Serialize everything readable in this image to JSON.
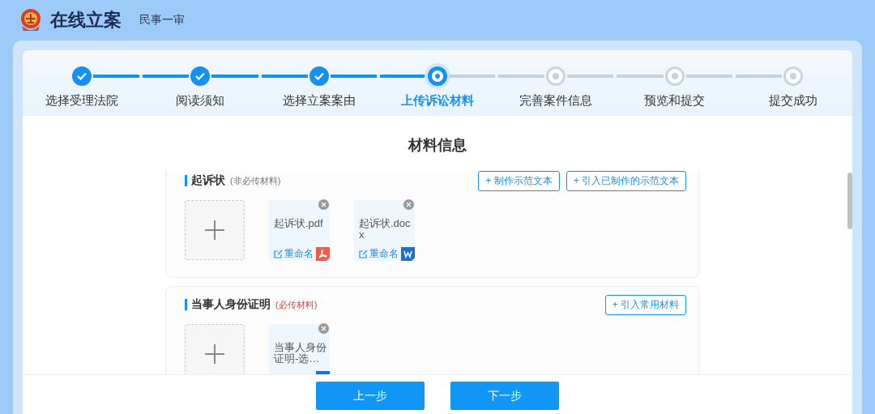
{
  "header": {
    "title": "在线立案",
    "subtitle": "民事一审"
  },
  "steps": [
    {
      "label": "选择受理法院",
      "done": true,
      "current": false
    },
    {
      "label": "阅读须知",
      "done": true,
      "current": false
    },
    {
      "label": "选择立案案由",
      "done": true,
      "current": false
    },
    {
      "label": "上传诉讼材料",
      "done": false,
      "current": true
    },
    {
      "label": "完善案件信息",
      "done": false,
      "current": false
    },
    {
      "label": "预览和提交",
      "done": false,
      "current": false
    },
    {
      "label": "提交成功",
      "done": false,
      "current": false
    }
  ],
  "page_title": "材料信息",
  "sections": [
    {
      "title": "起诉状",
      "note": "(非必传材料)",
      "required": false,
      "buttons": [
        "+ 制作示范文本",
        "+ 引入已制作的示范文本"
      ],
      "files": [
        {
          "name": "起诉状.pdf",
          "rename": "重命名",
          "kind": "pdf"
        },
        {
          "name": "起诉状.docx",
          "rename": "重命名",
          "kind": "word"
        }
      ]
    },
    {
      "title": "当事人身份证明",
      "note": "(必传材料)",
      "required": true,
      "buttons": [
        "+ 引入常用材料"
      ],
      "files": [
        {
          "name": "当事人身份证明-选…",
          "kind": "word"
        }
      ]
    }
  ],
  "footer_buttons": [
    "上一步",
    "下一步"
  ]
}
